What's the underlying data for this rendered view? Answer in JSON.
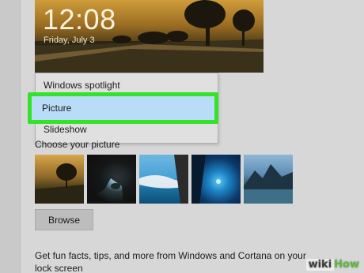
{
  "lock_preview": {
    "time": "12:08",
    "date": "Friday, July 3"
  },
  "background_dropdown": {
    "options": [
      "Windows spotlight",
      "Picture",
      "Slideshow"
    ],
    "highlight_color": "#35e22a"
  },
  "choose_picture": {
    "label": "Choose your picture",
    "thumbnails": [
      "sunset-road",
      "sea-cave",
      "beach-aerial",
      "underwater-diver",
      "mountain-lake"
    ]
  },
  "browse_button": "Browse",
  "fun_facts_text": "Get fun facts, tips, and more from Windows and Cortana on your lock screen",
  "watermark": {
    "wiki": "wiki",
    "how": "How"
  }
}
